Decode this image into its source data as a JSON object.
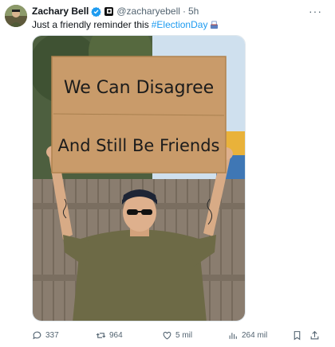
{
  "post": {
    "author_name": "Zachary Bell",
    "handle": "@zacharyebell",
    "separator": "·",
    "time": "5h",
    "more_glyph": "···",
    "text": "Just a friendly reminder this",
    "hashtag": "#ElectionDay"
  },
  "sign": {
    "line1": "We Can Disagree",
    "line2": "And Still Be Friends"
  },
  "actions": {
    "replies": "337",
    "reposts": "964",
    "likes": "5 mil",
    "views": "264 mil"
  },
  "colors": {
    "accent": "#1d9bf0",
    "muted": "#536471",
    "text": "#0f1419",
    "cardboard": "#c99b6a",
    "shirt": "#6d6a46",
    "fence": "#8a7d6f"
  },
  "icons": [
    "verified-badge-icon",
    "affiliate-badge-icon",
    "ballot-box-icon",
    "more-icon",
    "reply-icon",
    "repost-icon",
    "like-icon",
    "views-icon",
    "bookmark-icon",
    "share-icon"
  ]
}
